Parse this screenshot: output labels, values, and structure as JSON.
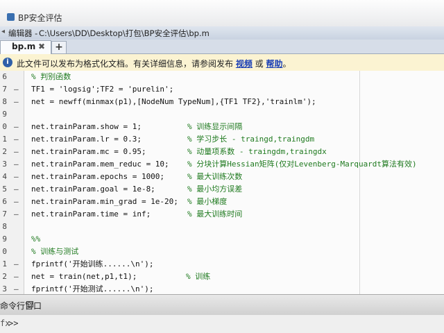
{
  "window": {
    "title": "BP安全评估"
  },
  "pathbar": {
    "bullet": "◂",
    "label": "编辑器 -",
    "path": "C:\\Users\\DD\\Desktop\\打包\\BP安全评估\\bp.m"
  },
  "tabs": [
    {
      "label": "bp.m",
      "close": "✖"
    }
  ],
  "new_tab": "+",
  "infobar": {
    "icon": "i",
    "message": "此文件可以发布为格式化文档。有关详细信息，请参阅发布",
    "link1": "视频",
    "connector": " 或 ",
    "link2": "帮助",
    "end": "。"
  },
  "code_lines": [
    {
      "ln": "6",
      "dash": "",
      "code": "% 判别函数",
      "comment": ""
    },
    {
      "ln": "7",
      "dash": "–",
      "code": "TF1 = 'logsig';TF2 = 'purelin';",
      "comment": ""
    },
    {
      "ln": "8",
      "dash": "–",
      "code": "net = newff(minmax(p1),[NodeNum TypeNum],{TF1 TF2},'trainlm');",
      "comment": ""
    },
    {
      "ln": "9",
      "dash": "",
      "code": "",
      "comment": ""
    },
    {
      "ln": "0",
      "dash": "–",
      "code": "net.trainParam.show = 1;",
      "comment": "% 训练显示间隔"
    },
    {
      "ln": "1",
      "dash": "–",
      "code": "net.trainParam.lr = 0.3;",
      "comment": "% 学习步长 - traingd,traingdm"
    },
    {
      "ln": "2",
      "dash": "–",
      "code": "net.trainParam.mc = 0.95;",
      "comment": "% 动量项系数 - traingdm,traingdx"
    },
    {
      "ln": "3",
      "dash": "–",
      "code": "net.trainParam.mem_reduc = 10;",
      "comment": "% 分块计算Hessian矩阵(仅对Levenberg-Marquardt算法有效)"
    },
    {
      "ln": "4",
      "dash": "–",
      "code": "net.trainParam.epochs = 1000;",
      "comment": "% 最大训练次数"
    },
    {
      "ln": "5",
      "dash": "–",
      "code": "net.trainParam.goal = 1e-8;",
      "comment": "% 最小均方误差"
    },
    {
      "ln": "6",
      "dash": "–",
      "code": "net.trainParam.min_grad = 1e-20;",
      "comment": "% 最小梯度"
    },
    {
      "ln": "7",
      "dash": "–",
      "code": "net.trainParam.time = inf;",
      "comment": "% 最大训练时间"
    },
    {
      "ln": "8",
      "dash": "",
      "code": "",
      "comment": ""
    },
    {
      "ln": "9",
      "dash": "",
      "code": "%%",
      "comment": ""
    },
    {
      "ln": "0",
      "dash": "",
      "code": "% 训练与测试",
      "comment": ""
    },
    {
      "ln": "1",
      "dash": "–",
      "code": "fprintf('开始训练......\\n');",
      "comment": ""
    },
    {
      "ln": "2",
      "dash": "–",
      "code": "net = train(net,p1,t1);",
      "comment": "% 训练"
    },
    {
      "ln": "3",
      "dash": "–",
      "code": "fprintf('开始测试......\\n');",
      "comment": ""
    }
  ],
  "command_window": {
    "label": "命令行窗口",
    "fx": "fx",
    "prompt": ">>"
  },
  "colors": {
    "comment": "#1f7a1f",
    "string": "#9b1fa0",
    "link": "#1a3fb5",
    "infobar_bg": "#fbf3d2"
  }
}
